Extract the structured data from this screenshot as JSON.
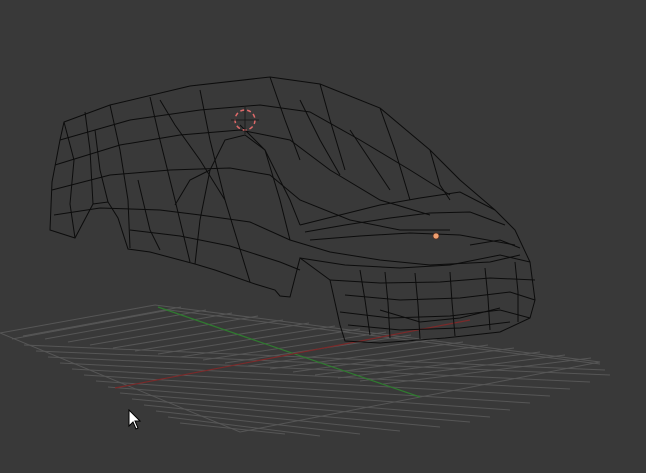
{
  "viewport": {
    "background": "#393939",
    "grid_color": "#555555",
    "x_axis_color": "#7a2a2a",
    "y_axis_color": "#2f7a2f",
    "wire_color": "#0b0b0b",
    "selection_color": "#e06a6a",
    "origin_color": "#f0a070"
  },
  "icons": {
    "cursor": "mouse-pointer-icon",
    "cursor3d": "3d-cursor-icon",
    "origin": "object-origin-icon"
  }
}
